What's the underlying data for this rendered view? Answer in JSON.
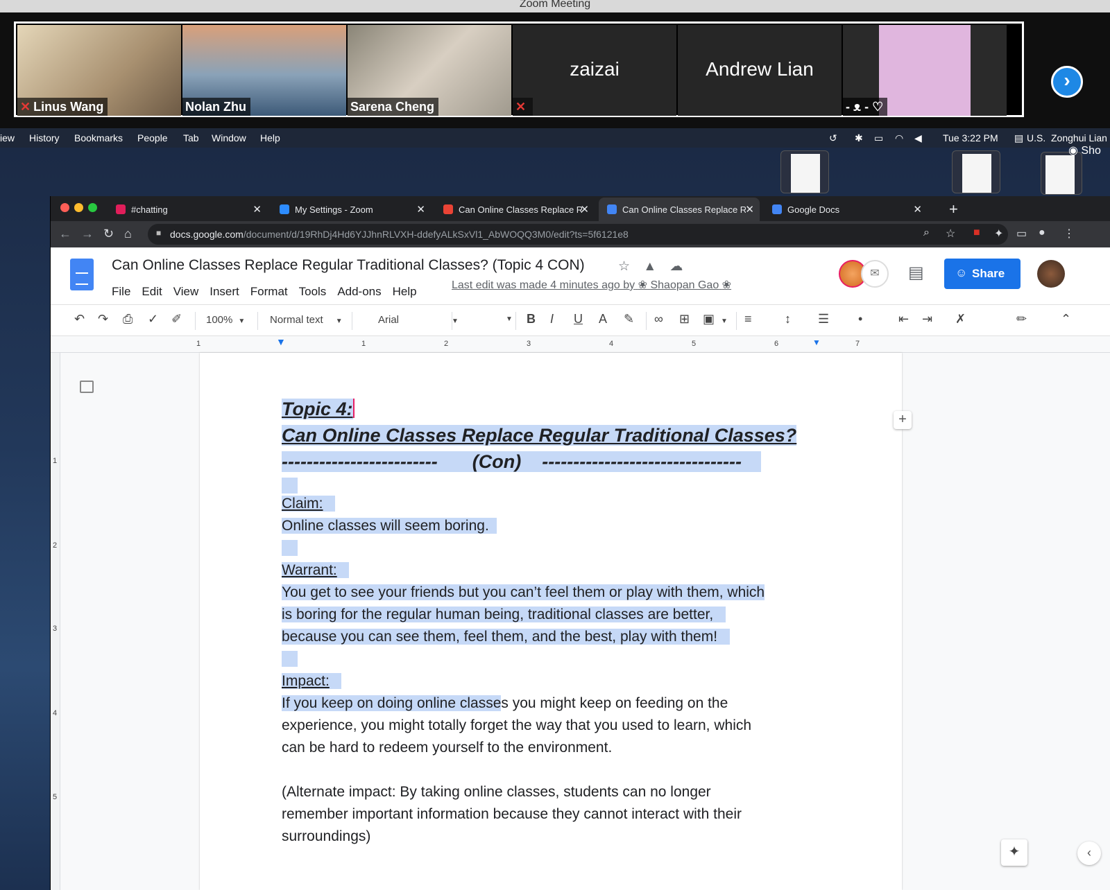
{
  "zoom": {
    "window_title": "Zoom Meeting",
    "participants": [
      {
        "name": "Linus Wang",
        "muted": true,
        "video": true,
        "bg": "#c9b89a"
      },
      {
        "name": "Nolan Zhu",
        "muted": false,
        "video": true,
        "bg": "#9fb2c4"
      },
      {
        "name": "Sarena Cheng",
        "muted": false,
        "video": true,
        "bg": "#b0a89a"
      },
      {
        "name": "zaizai",
        "muted": true,
        "video": false
      },
      {
        "name": "Andrew Lian",
        "muted": false,
        "video": false
      },
      {
        "name": "- ᴥ - ♡",
        "muted": false,
        "video": true,
        "bg": "#caa0c8"
      }
    ],
    "next_icon": "chevron-right-icon"
  },
  "mac_menubar": {
    "items": [
      "iew",
      "History",
      "Bookmarks",
      "People",
      "Tab",
      "Window",
      "Help"
    ],
    "clock": "Tue 3:22 PM",
    "input_source": "U.S.",
    "user": "Zonghui Lian",
    "screen_share_label": "Sho"
  },
  "browser": {
    "tabs": [
      {
        "title": "#chatting",
        "color": "#e01e5a",
        "active": false
      },
      {
        "title": "My Settings - Zoom",
        "color": "#2d8cff",
        "active": false
      },
      {
        "title": "Can Online Classes Replace Re",
        "color": "#ea4335",
        "active": false
      },
      {
        "title": "Can Online Classes Replace Re",
        "color": "#4285f4",
        "active": true
      },
      {
        "title": "Google Docs",
        "color": "#4285f4",
        "active": false
      }
    ],
    "url_host": "docs.google.com",
    "url_path": "/document/d/19RhDj4Hd6YJJhnRLVXH-ddefyALkSxVl1_AbWOQQ3M0/edit?ts=5f6121e8"
  },
  "docs": {
    "title": "Can Online Classes Replace Regular Traditional Classes? (Topic 4 CON)",
    "menu": [
      "File",
      "Edit",
      "View",
      "Insert",
      "Format",
      "Tools",
      "Add-ons",
      "Help"
    ],
    "last_edit": "Last edit was made 4 minutes ago by",
    "last_edit_user": "Shaopan Gao",
    "share_label": "Share",
    "toolbar": {
      "zoom": "100%",
      "style": "Normal text",
      "font": "Arial",
      "size": ""
    },
    "ruler_numbers": [
      "1",
      "1",
      "2",
      "3",
      "4",
      "5",
      "6",
      "7"
    ],
    "vruler_numbers": [
      "1",
      "2",
      "3",
      "4",
      "5"
    ],
    "content": {
      "h_topic": "Topic 4:",
      "h_question": "Can Online Classes Replace Regular Traditional Classes?",
      "h_con_left": "-------------------------",
      "h_con": "(Con)",
      "h_con_right": "--------------------------------",
      "claim_label": "Claim:",
      "claim_text": "Online classes will seem boring.",
      "warrant_label": "Warrant:",
      "warrant_l1": "You get to see your friends but you can’t feel them or play with them, which",
      "warrant_l2": "is boring for the regular human being, traditional classes are better,",
      "warrant_l3": "because you can see them, feel them, and the best, play with them!",
      "impact_label": "Impact:",
      "impact_l1_sel": "If you keep on doing online classe",
      "impact_l1_rest": "s you might keep on feeding on the",
      "impact_l2": "experience, you might totally forget the way that you used to learn, which",
      "impact_l3": "can be hard to redeem yourself to the environment.",
      "alt_l1": "(Alternate impact: By taking online classes, students can no longer",
      "alt_l2": "remember important information because they cannot interact with their",
      "alt_l3": "surroundings)"
    }
  }
}
